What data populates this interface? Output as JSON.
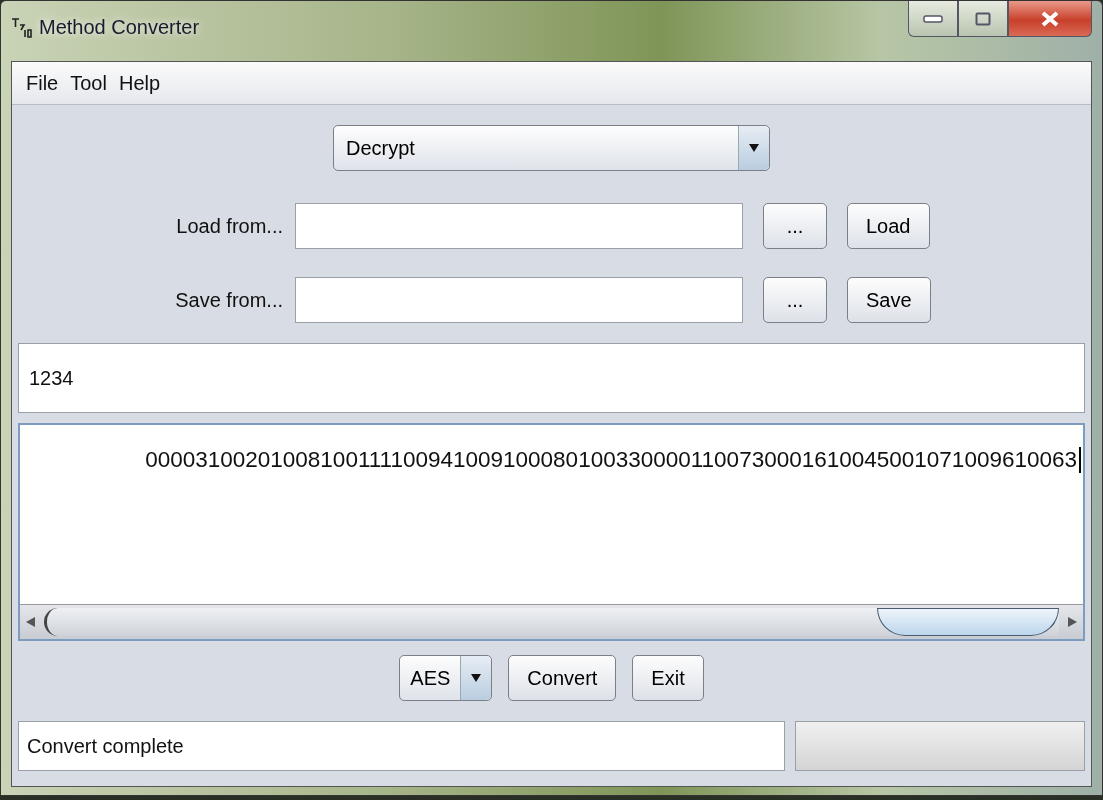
{
  "window": {
    "title": "Method Converter"
  },
  "menu": [
    {
      "label": "File"
    },
    {
      "label": "Tool"
    },
    {
      "label": "Help"
    }
  ],
  "mode_dropdown": {
    "value": "Decrypt"
  },
  "file_rows": [
    {
      "label": "Load from...",
      "value": "",
      "browse": "...",
      "action": "Load"
    },
    {
      "label": "Save from...",
      "value": "",
      "browse": "...",
      "action": "Save"
    }
  ],
  "key_field": {
    "value": "1234"
  },
  "output_area": {
    "value": "000031002010081001111009410091000801003300001100730001610045001071009610063"
  },
  "algorithm_dropdown": {
    "value": "AES"
  },
  "buttons": [
    "Convert",
    "Exit"
  ],
  "status_bar": {
    "message": "Convert complete",
    "progress": {
      "level": 0
    }
  }
}
